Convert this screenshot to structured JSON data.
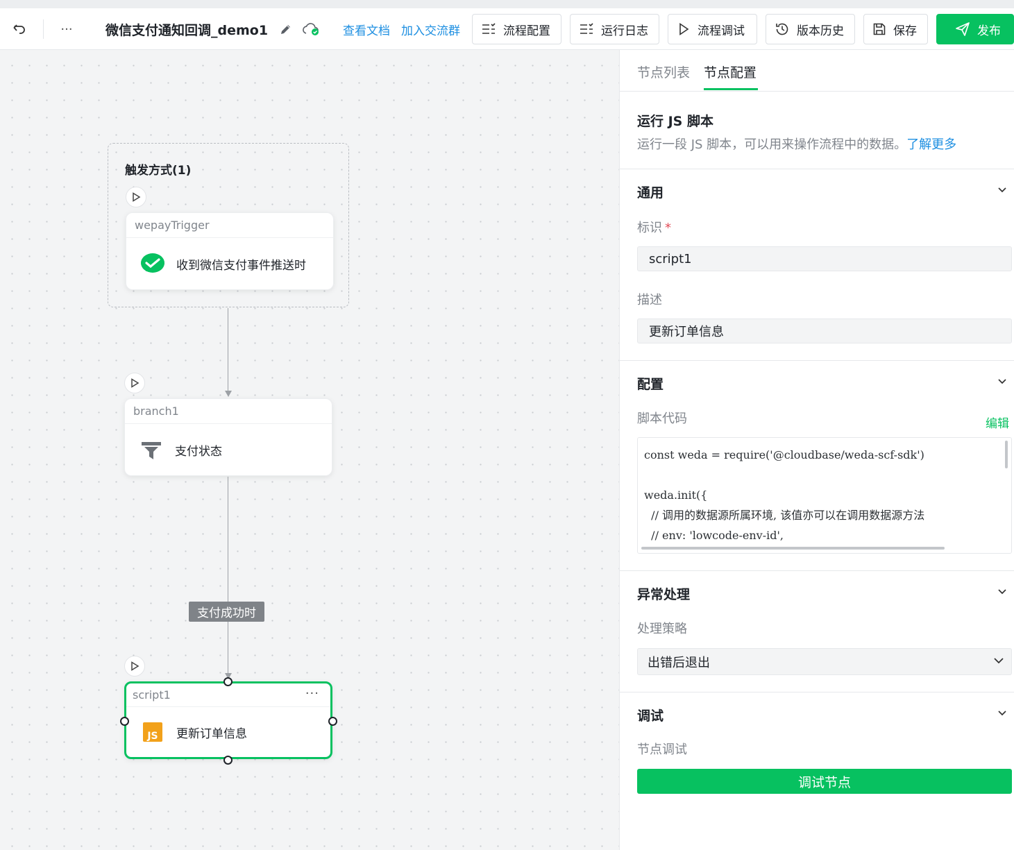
{
  "toolbar": {
    "flow_title": "微信支付通知回调_demo1",
    "more_label": "···",
    "links": {
      "docs": "查看文档",
      "community": "加入交流群"
    },
    "buttons": {
      "flow_config": "流程配置",
      "run_log": "运行日志",
      "flow_debug": "流程调试",
      "version_history": "版本历史",
      "save": "保存",
      "publish": "发布"
    }
  },
  "canvas": {
    "trigger_group_title": "触发方式(1)",
    "nodes": [
      {
        "id": "wepayTrigger",
        "label": "收到微信支付事件推送时",
        "icon": "wechat-pay-icon"
      },
      {
        "id": "branch1",
        "label": "支付状态",
        "icon": "filter-icon"
      },
      {
        "id": "script1",
        "label": "更新订单信息",
        "icon": "js-icon",
        "more": "···"
      }
    ],
    "edge_label": "支付成功时"
  },
  "panel": {
    "tabs": [
      "节点列表",
      "节点配置"
    ],
    "active_tab": "节点配置",
    "node_type_title": "运行 JS 脚本",
    "node_type_desc": "运行一段 JS 脚本，可以用来操作流程中的数据。",
    "learn_more": "了解更多",
    "sections": {
      "general": {
        "title": "通用",
        "id_label": "标识",
        "required_mark": "*",
        "id_value": "script1",
        "desc_label": "描述",
        "desc_value": "更新订单信息"
      },
      "config": {
        "title": "配置",
        "code_label": "脚本代码",
        "edit_link": "编辑",
        "code": "const weda = require('@cloudbase/weda-scf-sdk')\n\nweda.init({\n  // 调用的数据源所属环境, 该值亦可以在调用数据源方法\n  // env: 'lowcode-env-id',"
      },
      "error_handling": {
        "title": "异常处理",
        "strategy_label": "处理策略",
        "strategy_value": "出错后退出"
      },
      "debug": {
        "title": "调试",
        "node_debug_label": "节点调试",
        "debug_button": "调试节点"
      }
    }
  },
  "colors": {
    "brand_green": "#07c160",
    "link_blue": "#1e8fe1",
    "js_orange": "#f2a11a"
  }
}
